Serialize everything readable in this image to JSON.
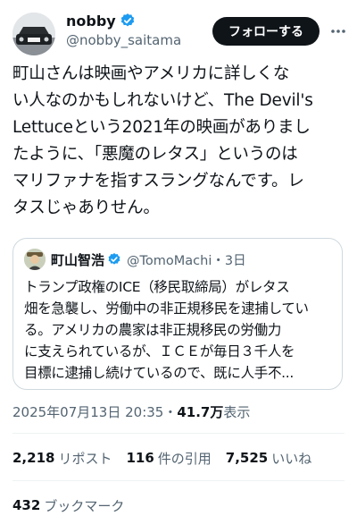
{
  "author": {
    "display_name": "nobby",
    "handle": "@nobby_saitama",
    "verified_color": "#1d9bf0"
  },
  "follow_label": "フォローする",
  "tweet": {
    "lines": [
      "町山さんは映画やアメリカに詳しくな",
      "い人なのかもしれないけど、The Devil's",
      "Lettuceという2021年の映画がありまし",
      "たように、「悪魔のレタス」というのは",
      "マリファナを指すスラングなんです。レ",
      "タスじゃありせん。"
    ]
  },
  "quote": {
    "display_name": "町山智浩",
    "handle_time": "@TomoMachi・3日",
    "lines": [
      "トランプ政権のICE（移民取締局）がレタス",
      "畑を急襲し、労働中の非正規移民を逮捕してい",
      "る。アメリカの農家は非正規移民の労働力",
      "に支えられているが、ＩＣＥが毎日３千人を",
      "目標に逮捕し続けているので、既に人手不..."
    ]
  },
  "meta": {
    "timestamp": "2025年07月13日 20:35・",
    "views_count": "41.7万",
    "views_label": " 表示"
  },
  "stats": {
    "reposts_count": "2,218",
    "reposts_label": "リポスト",
    "quotes_count": "116",
    "quotes_label": "件の引用",
    "likes_count": "7,525",
    "likes_label": "いいね",
    "bookmarks_count": "432",
    "bookmarks_label": "ブックマーク"
  }
}
